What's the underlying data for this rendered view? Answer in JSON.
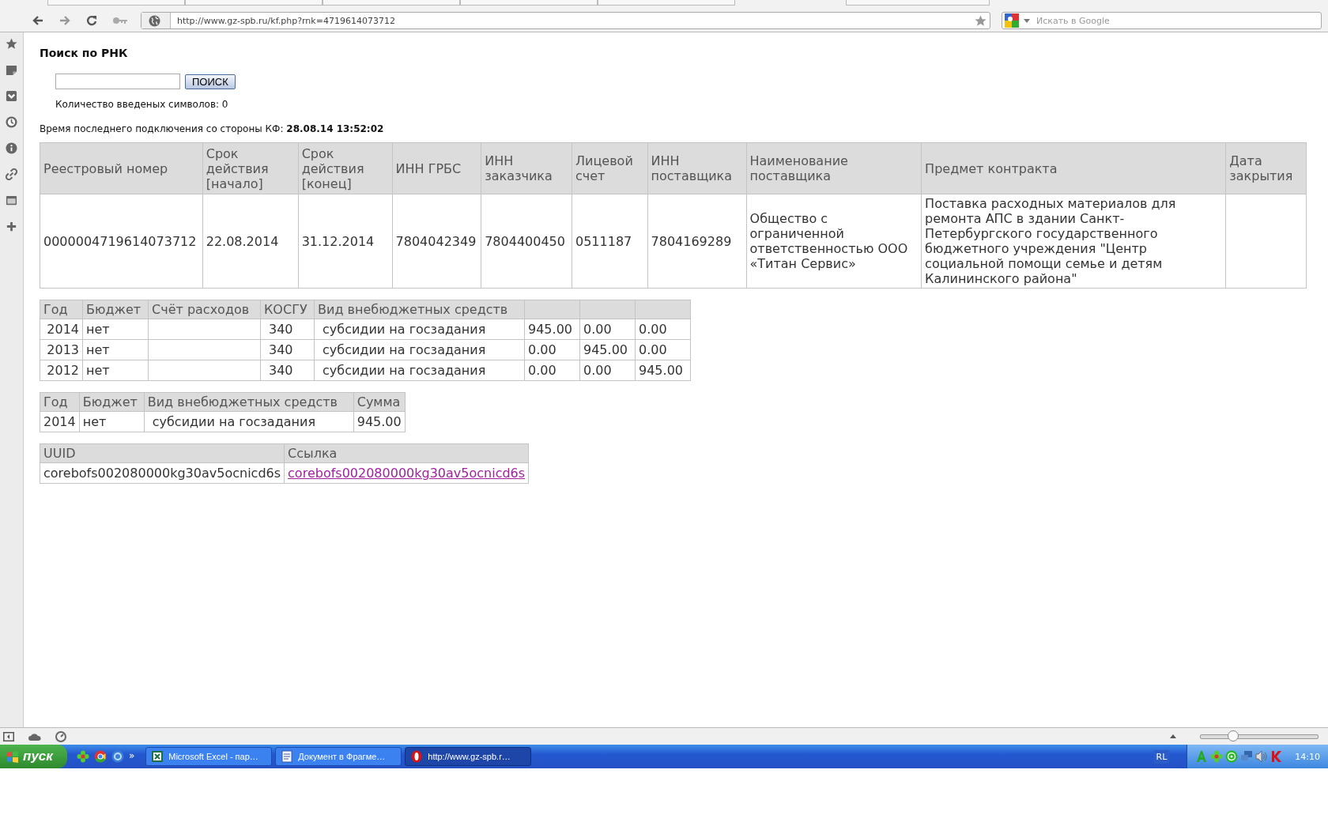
{
  "browser": {
    "address": "http://www.gz-spb.ru/kf.php?rnk=4719614073712",
    "search_placeholder": "Искать в Google"
  },
  "page": {
    "heading": "Поиск по РНК",
    "search_button": "ПОИСК",
    "char_count": "Количество введеных символов: 0",
    "last_connection_label": "Время последнего подключения со стороны КФ: ",
    "last_connection_time": "28.08.14 13:52:02"
  },
  "contract_table": {
    "columns": [
      "Реестровый номер",
      "Срок действия [начало]",
      "Срок действия [конец]",
      "ИНН ГРБС",
      "ИНН заказчика",
      "Лицевой счет",
      "ИНН поставщика",
      "Наименование поставщика",
      "Предмет контракта",
      "Дата закрытия"
    ],
    "rows": [
      [
        "0000004719614073712",
        "22.08.2014",
        "31.12.2014",
        "7804042349",
        "7804400450",
        "0511187",
        "7804169289",
        "Общество с ограниченной ответственностью ООО «Титан Сервис»",
        "Поставка расходных материалов для ремонта АПС в здании Санкт-Петербургского государственного бюджетного учреждения \"Центр социальной помощи семье и детям Калининского района\"",
        ""
      ]
    ]
  },
  "finance_table": {
    "columns": [
      "Год",
      "Бюджет",
      "Счёт расходов",
      "КОСГУ",
      "Вид внебюджетных средств",
      "",
      "",
      ""
    ],
    "rows": [
      [
        "2014",
        "нет",
        "",
        "340",
        "субсидии на госзадания",
        "945.00",
        "0.00",
        "0.00"
      ],
      [
        "2013",
        "нет",
        "",
        "340",
        "субсидии на госзадания",
        "0.00",
        "945.00",
        "0.00"
      ],
      [
        "2012",
        "нет",
        "",
        "340",
        "субсидии на госзадания",
        "0.00",
        "0.00",
        "945.00"
      ]
    ]
  },
  "sum_table": {
    "columns": [
      "Год",
      "Бюджет",
      "Вид внебюджетных средств",
      "Сумма"
    ],
    "rows": [
      [
        "2014",
        "нет",
        "субсидии на госзадания",
        "945.00"
      ]
    ]
  },
  "uuid_table": {
    "columns": [
      "UUID",
      "Ссылка"
    ],
    "rows": [
      [
        {
          "kind": "text",
          "text": "corebofs002080000kg30av5ocnicd6s"
        },
        {
          "kind": "link",
          "text": "corebofs002080000kg30av5ocnicd6s"
        }
      ]
    ]
  },
  "status_bar": {
    "zoom": {
      "level": 0.28
    }
  },
  "taskbar": {
    "start": "пуск",
    "more": "»",
    "tasks": [
      {
        "kind": "excel",
        "label": "Microsoft Excel - пар…",
        "selected": false
      },
      {
        "kind": "word",
        "label": "Документ в Фрагме…",
        "selected": false
      },
      {
        "kind": "opera",
        "label": "http://www.gz-spb.r…",
        "selected": true
      }
    ],
    "language": "RL",
    "clock": "14:10"
  }
}
